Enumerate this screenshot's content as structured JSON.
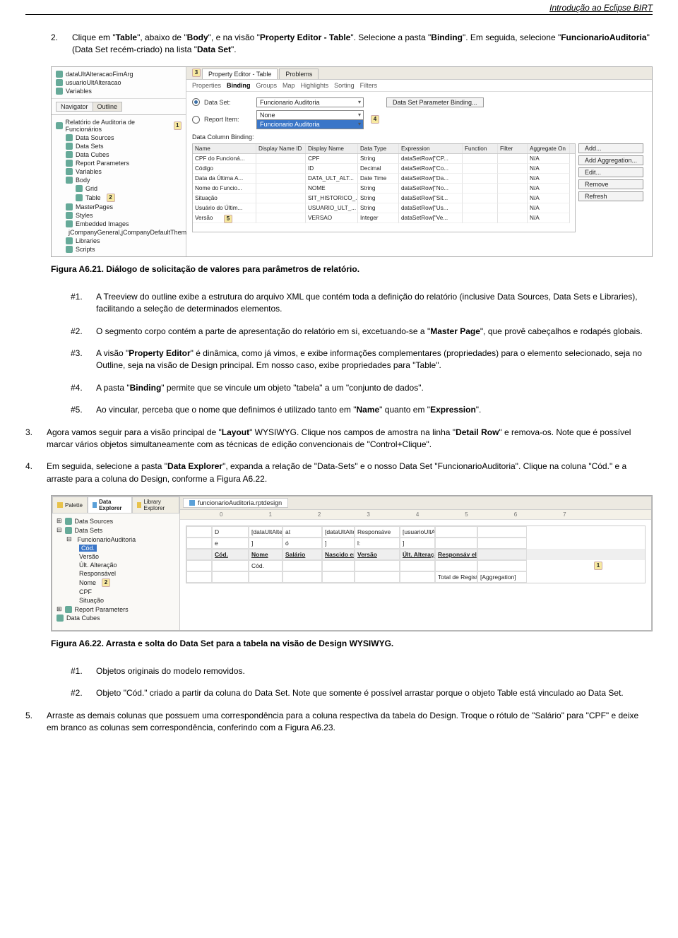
{
  "page_header": "Introdução ao Eclipse BIRT",
  "step2": {
    "num": "2.",
    "text_a": "Clique em \"",
    "b1": "Table",
    "text_b": "\", abaixo de \"",
    "b2": "Body",
    "text_c": "\", e na visão \"",
    "b3": "Property Editor - Table",
    "text_d": "\". Selecione a pasta \"",
    "b4": "Binding",
    "text_e": "\". Em seguida, selecione \"",
    "b5": "FuncionarioAuditoria",
    "text_f": "\" (Data Set recém-criado) na lista \"",
    "b6": "Data Set",
    "text_g": "\"."
  },
  "shot1": {
    "left_top_items": [
      "dataUltAlteracaoFimArg",
      "usuarioUltAlteracao",
      "Variables"
    ],
    "nav_tabs": [
      "Navigator",
      "Outline"
    ],
    "outline_root": "Relatório de Auditoria de Funcionários",
    "outline_root_badge": "1",
    "outline_items": [
      "Data Sources",
      "Data Sets",
      "Data Cubes",
      "Report Parameters",
      "Variables",
      "Body",
      "Grid",
      "Table",
      "MasterPages",
      "Styles",
      "Embedded Images",
      "jCompanyGeneral,jCompanyDefaultTheme",
      "Libraries",
      "Scripts"
    ],
    "table_badge": "2",
    "prop_tabs": [
      "Property Editor - Table",
      "Problems"
    ],
    "prop_tabs_badge": "3",
    "prop_subtabs": [
      "Properties",
      "Binding",
      "Groups",
      "Map",
      "Highlights",
      "Sorting",
      "Filters"
    ],
    "dataset_label": "Data Set:",
    "dataset_value": "Funcionario Auditoria",
    "btn_dsp": "Data Set Parameter Binding...",
    "report_item_label": "Report Item:",
    "report_item_none": "None",
    "report_item_sel": "Funcionario Auditoria",
    "binding_badge": "4",
    "data_col_binding": "Data Column Binding:",
    "grid_headers": [
      "Name",
      "Display Name ID",
      "Display Name",
      "Data Type",
      "Expression",
      "Function",
      "Filter",
      "Aggregate On"
    ],
    "grid_rows": [
      [
        "CPF do Funcioná...",
        "",
        "CPF",
        "String",
        "dataSetRow[\"CP...",
        "",
        "",
        "N/A"
      ],
      [
        "Código",
        "",
        "ID",
        "Decimal",
        "dataSetRow[\"Co...",
        "",
        "",
        "N/A"
      ],
      [
        "Data da Última A...",
        "",
        "DATA_ULT_ALT...",
        "Date Time",
        "dataSetRow[\"Da...",
        "",
        "",
        "N/A"
      ],
      [
        "Nome do Funcio...",
        "",
        "NOME",
        "String",
        "dataSetRow[\"No...",
        "",
        "",
        "N/A"
      ],
      [
        "Situação",
        "",
        "SIT_HISTORICO_...",
        "String",
        "dataSetRow[\"Sit...",
        "",
        "",
        "N/A"
      ],
      [
        "Usuário do Últim...",
        "",
        "USUARIO_ULT_...",
        "String",
        "dataSetRow[\"Us...",
        "",
        "",
        "N/A"
      ],
      [
        "Versão",
        "",
        "VERSAO",
        "Integer",
        "dataSetRow[\"Ve...",
        "",
        "",
        "N/A"
      ]
    ],
    "row_badge": "5",
    "side_buttons": [
      "Add...",
      "Add Aggregation...",
      "Edit...",
      "Remove",
      "Refresh"
    ]
  },
  "fig21": "Figura A6.21. Diálogo de solicitação de valores para parâmetros de relatório.",
  "notes": [
    {
      "n": "#1.",
      "t": "A Treeview do outline exibe a estrutura do arquivo XML que contém toda a definição do relatório (inclusive Data Sources, Data Sets e Libraries), facilitando a seleção de determinados elementos."
    },
    {
      "n": "#2.",
      "pre": "O segmento corpo contém a parte de apresentação do relatório em si, excetuando-se a \"",
      "b": "Master Page",
      "post": "\", que provê cabeçalhos e rodapés globais."
    },
    {
      "n": "#3.",
      "pre": "A visão \"",
      "b": "Property Editor",
      "post": "\" é dinâmica, como já vimos, e exibe informações complementares (propriedades) para o elemento selecionado, seja no Outline, seja na visão de Design principal. Em nosso caso, exibe propriedades para \"Table\"."
    },
    {
      "n": "#4.",
      "pre": "A pasta \"",
      "b": "Binding",
      "post": "\" permite que se vincule um objeto \"tabela\" a um \"conjunto de dados\"."
    },
    {
      "n": "#5.",
      "pre": "Ao vincular, perceba que o nome que definimos é utilizado tanto em \"",
      "b": "Name",
      "mid": "\" quanto em \"",
      "b2": "Expression",
      "post": "\"."
    }
  ],
  "step3": {
    "num": "3.",
    "pre": "Agora vamos seguir para a visão principal de \"",
    "b1": "Layout",
    "mid": "\" WYSIWYG. Clique nos campos de amostra na linha \"",
    "b2": "Detail Row",
    "post": "\" e remova-os. Note que é possível marcar vários objetos simultaneamente com as técnicas de edição convencionais de \"Control+Clique\"."
  },
  "step4": {
    "num": "4.",
    "pre": "Em seguida, selecione a pasta \"",
    "b1": "Data Explorer",
    "post": "\", expanda a relação de \"Data-Sets\" e o nosso Data Set \"FuncionarioAuditoria\". Clique na coluna \"Cód.\" e a arraste para a coluna do Design, conforme a Figura A6.22."
  },
  "shot2": {
    "explorer_tabs": [
      "Palette",
      "Data Explorer",
      "Library Explorer"
    ],
    "tree": {
      "data_sources": "Data Sources",
      "data_sets": "Data Sets",
      "ds": "FuncionarioAuditoria",
      "cols": [
        "Cód.",
        "Versão",
        "Últ. Alteração",
        "Responsável",
        "Nome",
        "CPF",
        "Situação"
      ],
      "rp": "Report Parameters",
      "dc": "Data Cubes"
    },
    "left_badge": "2",
    "editor_file": "funcionarioAuditoria.rptdesign",
    "ruler": [
      "0",
      "1",
      "2",
      "3",
      "4",
      "5",
      "6",
      "7"
    ],
    "row1": [
      "",
      "D",
      "[dataUltAlteracao...",
      "at",
      "[dataUltAlteracao...",
      "Responsáve",
      "[usuarioUltAltera...",
      "",
      ""
    ],
    "row1b": [
      "",
      "e",
      "]",
      "ó",
      "]",
      "l:",
      "]",
      "",
      ""
    ],
    "hdr": [
      "",
      "Cód.",
      "Nome",
      "Salário",
      "Nascido em",
      "Versão",
      "Últ. Alteração",
      "Responsáv el",
      ""
    ],
    "detail_badge": "1",
    "detail_row": [
      "",
      "",
      "Cód.",
      "",
      "",
      "",
      "",
      "",
      ""
    ],
    "footer": [
      "",
      "",
      "",
      "",
      "",
      "",
      "",
      "Total de Registros:",
      "[Aggregation]"
    ]
  },
  "fig22": "Figura A6.22. Arrasta e solta do Data Set para a tabela na visão de Design WYSIWYG.",
  "end_notes": [
    {
      "n": "#1.",
      "t": "Objetos originais do modelo removidos."
    },
    {
      "n": "#2.",
      "t": "Objeto \"Cód.\" criado a partir da coluna do Data Set. Note que somente é possível arrastar porque o objeto Table está vinculado ao Data Set."
    }
  ],
  "step5": {
    "num": "5.",
    "t": "Arraste as demais colunas que possuem uma correspondência para a coluna respectiva da tabela do Design. Troque o rótulo de \"Salário\" para \"CPF\" e deixe em branco as colunas sem correspondência, conferindo com a Figura A6.23."
  }
}
